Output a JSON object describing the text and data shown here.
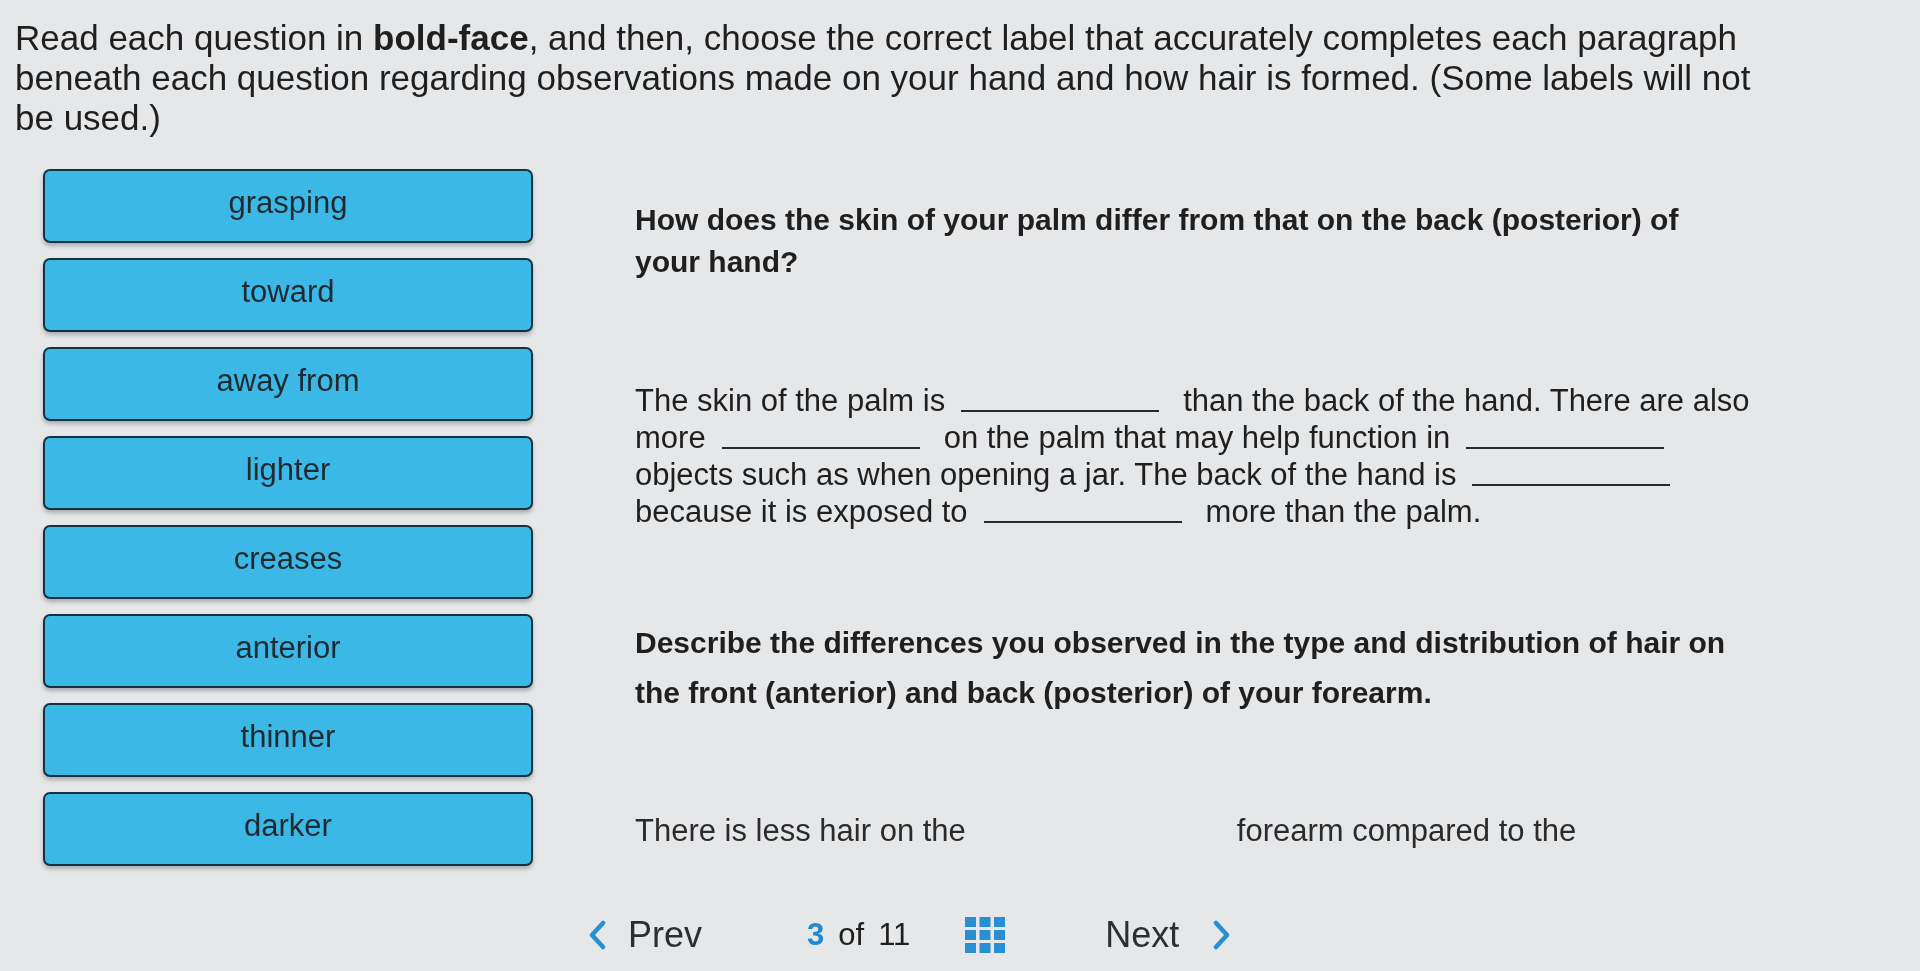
{
  "instructions": "Read each question in **bold-face**, and then, choose the correct label that accurately completes each paragraph beneath each question regarding observations made on your hand and how hair is formed. (Some labels will not be used.)",
  "labels": [
    "grasping",
    "toward",
    "away from",
    "lighter",
    "creases",
    "anterior",
    "thinner",
    "darker"
  ],
  "questions": [
    {
      "prompt": "How does the skin of your palm differ from that on the back (posterior) of your hand?",
      "lines": [
        [
          {
            "kind": "text",
            "text": "The skin of the palm is"
          },
          {
            "kind": "blank"
          },
          {
            "kind": "text",
            "text": "than the back of the hand. There are also"
          }
        ],
        [
          {
            "kind": "text",
            "text": "more"
          },
          {
            "kind": "blank"
          },
          {
            "kind": "text",
            "text": "on the palm that may help function in"
          },
          {
            "kind": "blank"
          }
        ],
        [
          {
            "kind": "text",
            "text": "objects such as when opening a jar. The back of the hand is"
          },
          {
            "kind": "blank"
          }
        ],
        [
          {
            "kind": "text",
            "text": "because it is exposed to"
          },
          {
            "kind": "blank"
          },
          {
            "kind": "text",
            "text": "more than the palm."
          }
        ]
      ]
    },
    {
      "prompt": "Describe the differences you observed in the type and distribution of hair on the front (anterior) and back (posterior) of your forearm.",
      "lines": [
        [
          {
            "kind": "text",
            "text": "There is less hair on the"
          },
          {
            "kind": "text",
            "text": "forearm compared to the"
          }
        ]
      ]
    }
  ],
  "pager": {
    "prev": "Prev",
    "current": "3",
    "of": "of",
    "total": "11",
    "next": "Next"
  }
}
